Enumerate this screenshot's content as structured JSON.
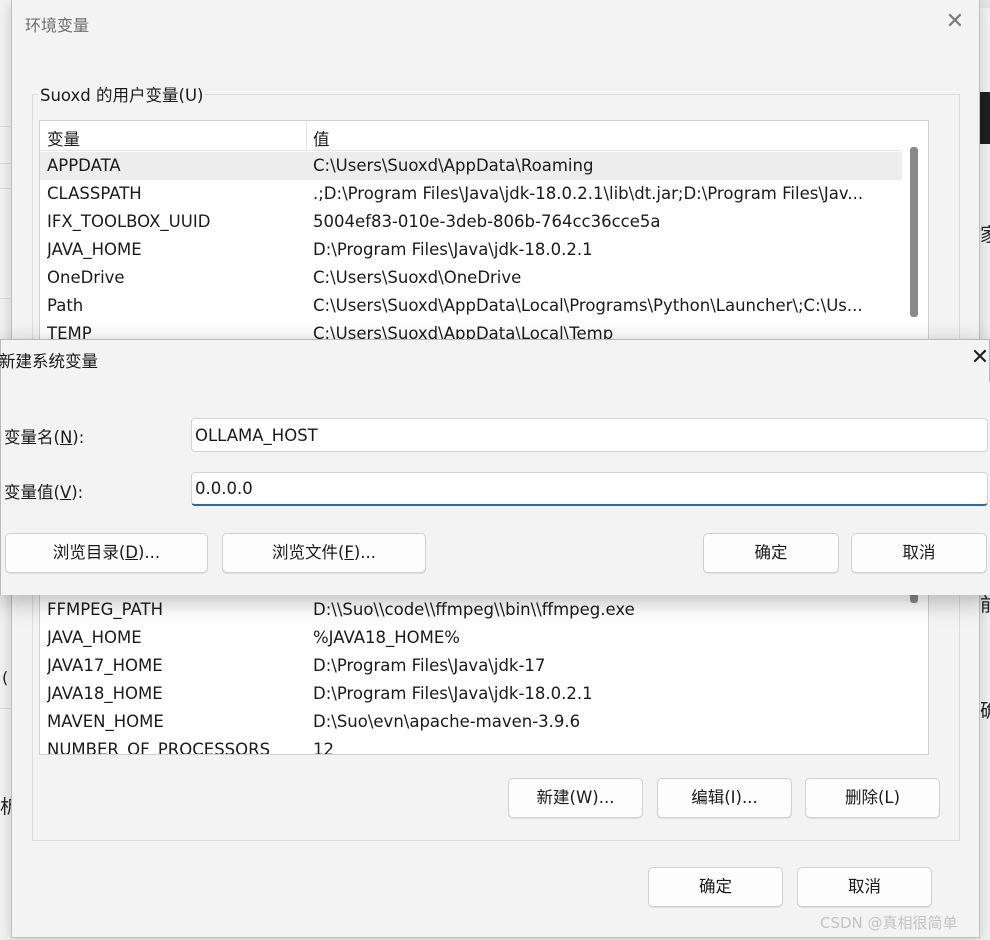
{
  "background": {
    "glyphs": [
      "家",
      "确",
      "析",
      "(",
      "前"
    ]
  },
  "env_dialog": {
    "title": "环境变量",
    "close_glyph": "✕",
    "user_vars": {
      "group_label": "Suoxd 的用户变量(U)",
      "columns": [
        "变量",
        "值"
      ],
      "rows": [
        {
          "name": "APPDATA",
          "value": "C:\\Users\\Suoxd\\AppData\\Roaming",
          "selected": true
        },
        {
          "name": "CLASSPATH",
          "value": ".;D:\\Program Files\\Java\\jdk-18.0.2.1\\lib\\dt.jar;D:\\Program Files\\Jav..."
        },
        {
          "name": "IFX_TOOLBOX_UUID",
          "value": "5004ef83-010e-3deb-806b-764cc36cce5a"
        },
        {
          "name": "JAVA_HOME",
          "value": "D:\\Program Files\\Java\\jdk-18.0.2.1"
        },
        {
          "name": "OneDrive",
          "value": "C:\\Users\\Suoxd\\OneDrive"
        },
        {
          "name": "Path",
          "value": "C:\\Users\\Suoxd\\AppData\\Local\\Programs\\Python\\Launcher\\;C:\\Us..."
        },
        {
          "name": "TEMP",
          "value": "C:\\Users\\Suoxd\\AppData\\Local\\Temp"
        }
      ]
    },
    "system_vars": {
      "rows": [
        {
          "name": "FFMPEG_PATH",
          "value": "D:\\\\Suo\\\\code\\\\ffmpeg\\\\bin\\\\ffmpeg.exe"
        },
        {
          "name": "JAVA_HOME",
          "value": "%JAVA18_HOME%"
        },
        {
          "name": "JAVA17_HOME",
          "value": "D:\\Program Files\\Java\\jdk-17"
        },
        {
          "name": "JAVA18_HOME",
          "value": "D:\\Program Files\\Java\\jdk-18.0.2.1"
        },
        {
          "name": "MAVEN_HOME",
          "value": "D:\\Suo\\evn\\apache-maven-3.9.6"
        },
        {
          "name": "NUMBER_OF_PROCESSORS",
          "value": "12"
        }
      ],
      "buttons": {
        "new": "新建(W)...",
        "edit": "编辑(I)...",
        "delete": "删除(L)"
      }
    },
    "buttons": {
      "ok": "确定",
      "cancel": "取消"
    }
  },
  "new_var_dialog": {
    "title": "新建系统变量",
    "close_glyph": "✕",
    "name_label": {
      "text": "变量名(",
      "mnemonic": "N",
      "suffix": "):"
    },
    "value_label": {
      "text": "变量值(",
      "mnemonic": "V",
      "suffix": "):"
    },
    "name_value": "OLLAMA_HOST",
    "value_value": "0.0.0.0",
    "browse_dir": {
      "text": "浏览目录(",
      "mnemonic": "D",
      "suffix": ")..."
    },
    "browse_file": {
      "text": "浏览文件(",
      "mnemonic": "F",
      "suffix": ")..."
    },
    "ok": "确定",
    "cancel": "取消"
  },
  "watermark": "CSDN @真相很简单"
}
